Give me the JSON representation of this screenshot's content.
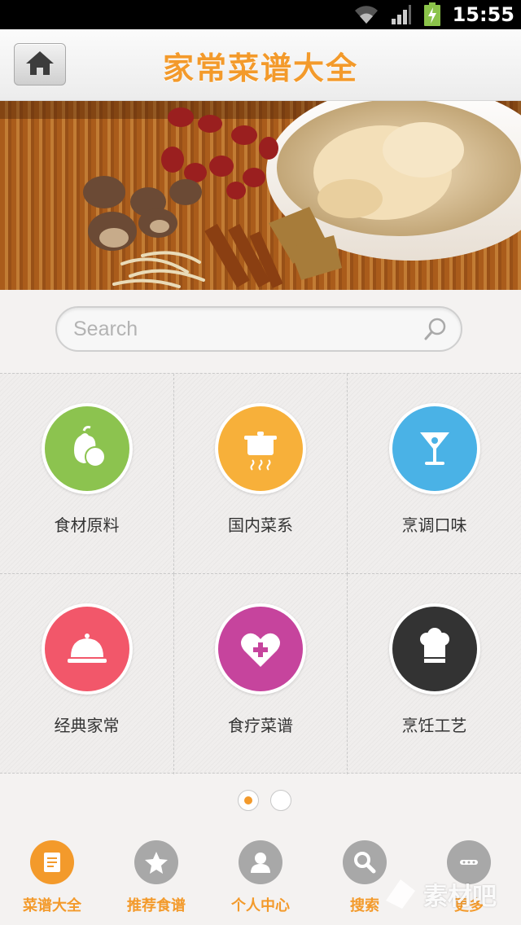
{
  "status_bar": {
    "time": "15:55"
  },
  "header": {
    "title": "家常菜谱大全"
  },
  "search": {
    "placeholder": "Search"
  },
  "categories": [
    {
      "label": "食材原料",
      "icon": "vegetables-icon",
      "color": "#8cc34f"
    },
    {
      "label": "国内菜系",
      "icon": "steaming-pot-icon",
      "color": "#f7b03a"
    },
    {
      "label": "烹调口味",
      "icon": "cocktail-glass-icon",
      "color": "#4ab2e6"
    },
    {
      "label": "经典家常",
      "icon": "food-cloche-icon",
      "color": "#f2576a"
    },
    {
      "label": "食疗菜谱",
      "icon": "heart-plus-icon",
      "color": "#c6449d"
    },
    {
      "label": "烹饪工艺",
      "icon": "chef-hat-icon",
      "color": "#333333"
    }
  ],
  "pager": {
    "total": 2,
    "active": 1
  },
  "bottom_nav": [
    {
      "label": "菜谱大全",
      "icon": "menu-book-icon",
      "active": true
    },
    {
      "label": "推荐食谱",
      "icon": "star-icon",
      "active": false
    },
    {
      "label": "个人中心",
      "icon": "user-icon",
      "active": false
    },
    {
      "label": "搜索",
      "icon": "search-icon",
      "active": false
    },
    {
      "label": "更多",
      "icon": "more-icon",
      "active": false
    }
  ],
  "watermark": {
    "text": "素材吧"
  },
  "colors": {
    "accent": "#f39a2b"
  }
}
